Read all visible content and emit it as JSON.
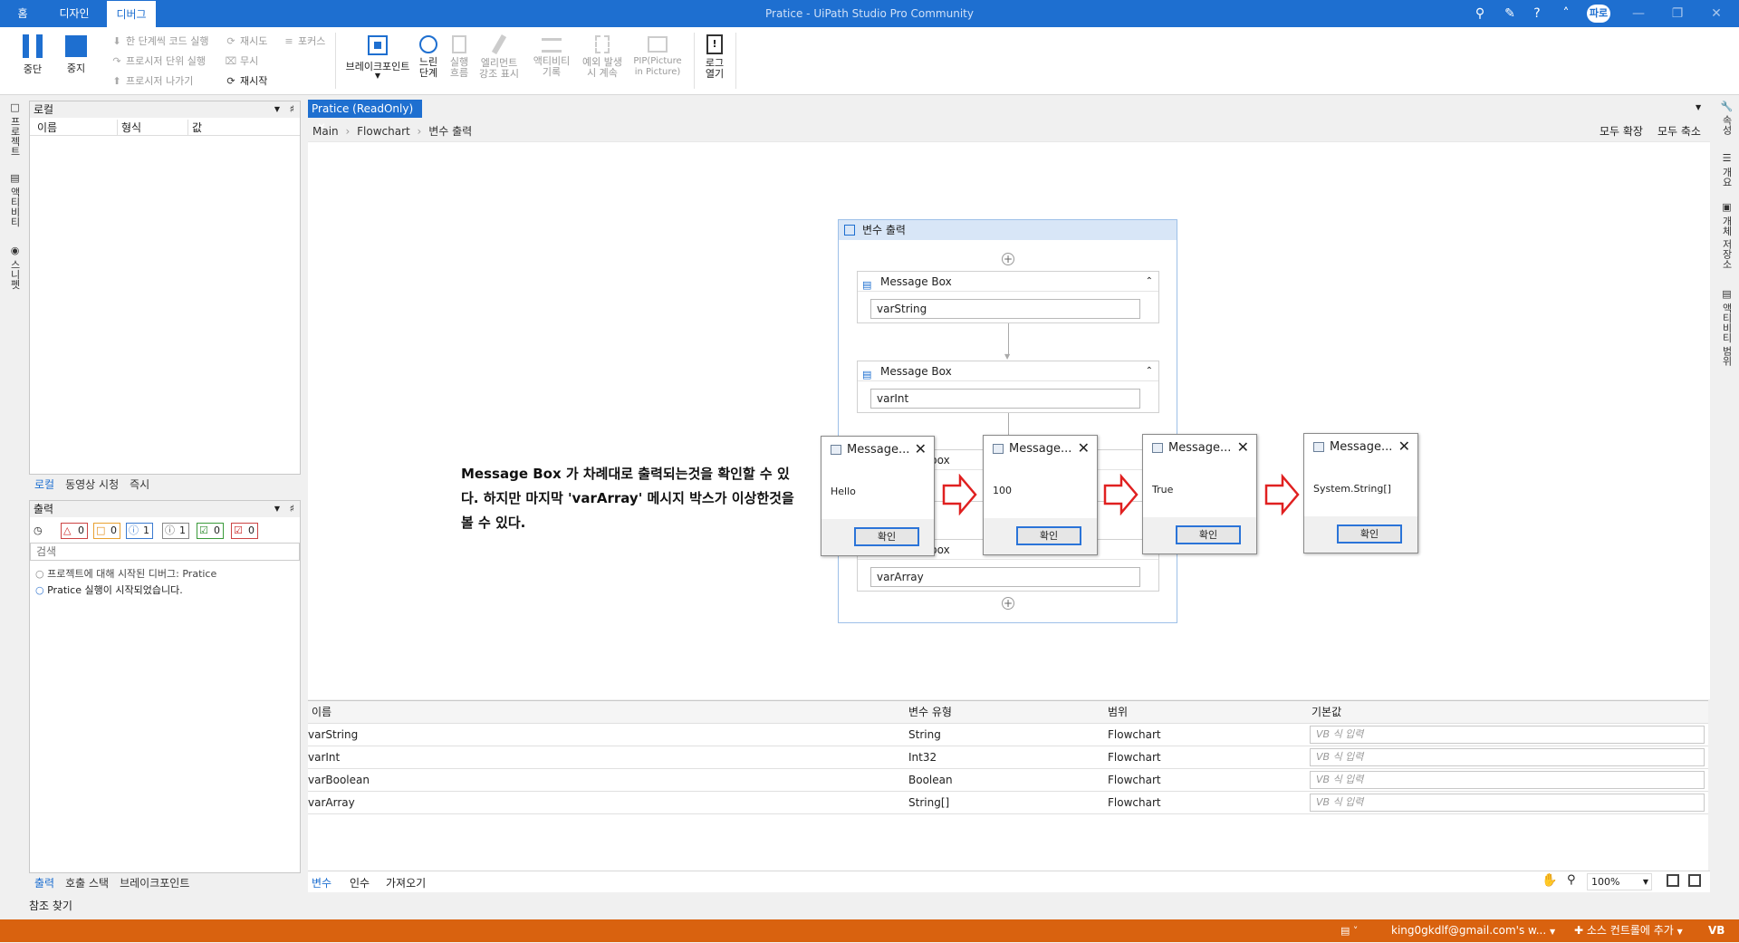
{
  "titlebar": {
    "tabs": [
      "홈",
      "디자인",
      "디버그"
    ],
    "window_title": "Pratice - UiPath Studio Pro Community",
    "user": "파로"
  },
  "ribbon": {
    "pause": "중단",
    "stop": "중지",
    "step_into": "한 단계씩 코드 실행",
    "step_over": "프로시저 단위 실행",
    "step_out": "프로시저 나가기",
    "retry": "재시도",
    "ignore": "무시",
    "restart": "재시작",
    "focus": "포커스",
    "breakpoints": "브레이크포인트",
    "slow_step": [
      "느린",
      "단계"
    ],
    "execution_trail": [
      "실행",
      "흐름"
    ],
    "highlight_elements": [
      "엘리먼트",
      "강조 표시"
    ],
    "log_activities": [
      "액티비티",
      "기록"
    ],
    "continue_on_exception": [
      "예외 발생",
      "시 계속"
    ],
    "pip": [
      "PIP(Picture",
      "in Picture)"
    ],
    "open_logs": [
      "로그",
      "열기"
    ]
  },
  "left_rail": [
    "프로젝트",
    "액티비티",
    "스니펫"
  ],
  "right_rail": [
    "속성",
    "개요",
    "개체 저장소",
    "액티비티 범위"
  ],
  "locals_panel": {
    "title": "로컬",
    "columns": [
      "이름",
      "형식",
      "값"
    ],
    "tabs": [
      "로컬",
      "동영상 시청",
      "즉시"
    ]
  },
  "output_panel": {
    "title": "출력",
    "counts": [
      "0",
      "0",
      "1",
      "1",
      "0",
      "0"
    ],
    "search_placeholder": "검색",
    "lines": [
      "프로젝트에 대해 시작된 디버그: Pratice",
      "Pratice 실행이 시작되었습니다."
    ],
    "tabs": [
      "출력",
      "호출 스택",
      "브레이크포인트"
    ]
  },
  "find_refs": "참조 찾기",
  "document": {
    "tab": "Pratice (ReadOnly)",
    "breadcrumb": [
      "Main",
      "Flowchart",
      "변수 출력"
    ],
    "expand_all": "모두 확장",
    "collapse_all": "모두 축소"
  },
  "sequence": {
    "title": "변수 출력",
    "activities": [
      {
        "title": "Message Box",
        "value": "varString"
      },
      {
        "title": "Message Box",
        "value": "varInt"
      },
      {
        "title": "box",
        "value": ""
      },
      {
        "title": "box",
        "value": "varArray"
      }
    ]
  },
  "message_boxes": [
    {
      "title": "Message...",
      "text": "Hello",
      "button": "확인"
    },
    {
      "title": "Message...",
      "text": "100",
      "button": "확인"
    },
    {
      "title": "Message...",
      "text": "True",
      "button": "확인"
    },
    {
      "title": "Message...",
      "text": "System.String[]",
      "button": "확인"
    }
  ],
  "annotation": "Message Box 가 차례대로 출력되는것을 확인할 수 있다. 하지만 마지막 'varArray' 메시지 박스가 이상한것을 볼 수 있다.",
  "variables": {
    "columns": [
      "이름",
      "변수 유형",
      "범위",
      "기본값"
    ],
    "rows": [
      {
        "name": "varString",
        "type": "String",
        "scope": "Flowchart",
        "default": "VB 식 입력"
      },
      {
        "name": "varInt",
        "type": "Int32",
        "scope": "Flowchart",
        "default": "VB 식 입력"
      },
      {
        "name": "varBoolean",
        "type": "Boolean",
        "scope": "Flowchart",
        "default": "VB 식 입력"
      },
      {
        "name": "varArray",
        "type": "String[]",
        "scope": "Flowchart",
        "default": "VB 식 입력"
      }
    ],
    "tabs": [
      "변수",
      "인수",
      "가져오기"
    ],
    "zoom": "100%"
  },
  "statusbar": {
    "account": "king0gkdlf@gmail.com's w...",
    "source_control": "소스 컨트롤에 추가",
    "lang": "VB"
  },
  "colors": {
    "accent": "#1e6fd0",
    "status": "#d9620f",
    "arrow": "#e02020"
  }
}
